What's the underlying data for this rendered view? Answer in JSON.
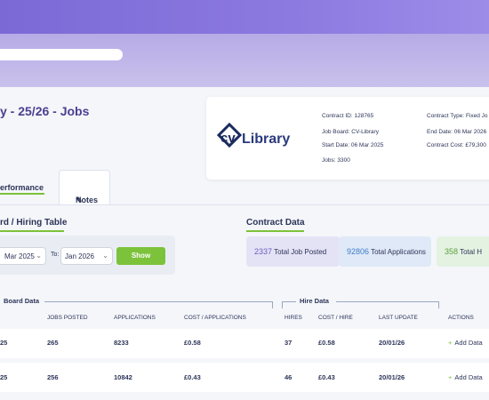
{
  "page": {
    "title": "y - 25/26 - Jobs"
  },
  "contract": {
    "logo_text": "CV Library",
    "id_label": "Contract ID:",
    "id_value": "128765",
    "board_label": "Job Board:",
    "board_value": "CV-Library",
    "start_label": "Start Date:",
    "start_value": "06 Mar 2025",
    "jobs_label": "Jobs:",
    "jobs_value": "3300",
    "type_label": "Contract Type:",
    "type_value": "Fixed Jo",
    "end_label": "End Date:",
    "end_value": "06 Mar 2026",
    "cost_label": "Contract Cost:",
    "cost_value": "£79,300"
  },
  "tabs": {
    "performance": "erformance",
    "notes": "Notes"
  },
  "sections": {
    "hiring": "rd / Hiring Table",
    "contract_data": "Contract Data"
  },
  "filter": {
    "from_value": "Mar 2025",
    "to_label": "To:",
    "to_value": "Jan 2026",
    "show_label": "Show"
  },
  "stats": [
    {
      "value": "2337",
      "label": "Total Job Posted",
      "color": "#e4e3f6",
      "num_color": "#6a5fc0"
    },
    {
      "value": "92806",
      "label": "Total Applications",
      "color": "#dfe9f7",
      "num_color": "#3f7fc8"
    },
    {
      "value": "358",
      "label": "Total H",
      "color": "#e4f2e2",
      "num_color": "#5aa33a"
    }
  ],
  "table": {
    "group_board": "Board Data",
    "group_hire": "Hire Data",
    "headers": {
      "jobs_posted": "JOBS POSTED",
      "applications": "APPLICATIONS",
      "cost_app": "COST / APPLICATIONS",
      "hires": "HIRES",
      "cost_hire": "COST / HIRE",
      "last_update": "LAST UPDATE",
      "actions": "ACTIONS"
    },
    "rows": [
      {
        "period": "25",
        "jobs_posted": "265",
        "applications": "8233",
        "cost_app": "£0.58",
        "hires": "37",
        "cost_hire": "£0.58",
        "last_update": "20/01/26",
        "action": "Add Data"
      },
      {
        "period": "25",
        "jobs_posted": "256",
        "applications": "10842",
        "cost_app": "£0.43",
        "hires": "46",
        "cost_hire": "£0.43",
        "last_update": "20/01/26",
        "action": "Add Data"
      }
    ]
  },
  "colors": {
    "accent": "#7cc23a",
    "brand": "#4a3f8f"
  }
}
